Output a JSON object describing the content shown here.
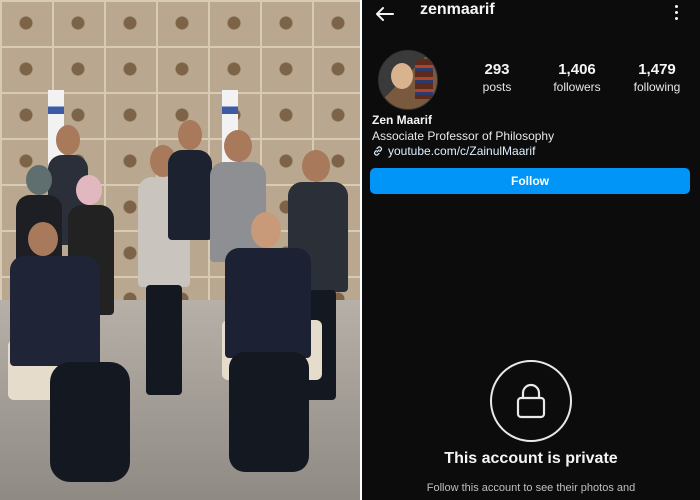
{
  "profile": {
    "username": "zenmaarif",
    "stats": [
      {
        "value": "293",
        "label": "posts"
      },
      {
        "value": "1,406",
        "label": "followers"
      },
      {
        "value": "1,479",
        "label": "following"
      }
    ],
    "display_name": "Zen Maarif",
    "bio": "Associate Professor of Philosophy",
    "link": "youtube.com/c/ZainulMaarif",
    "follow_label": "Follow",
    "private_title": "This account is private",
    "private_subtitle": "Follow this account to see their photos and"
  },
  "icons": {
    "back": "back-arrow-icon",
    "more": "more-vertical-icon",
    "link": "link-icon",
    "lock": "lock-icon"
  },
  "colors": {
    "follow_button": "#0095f6",
    "background": "#0c0c0c"
  }
}
